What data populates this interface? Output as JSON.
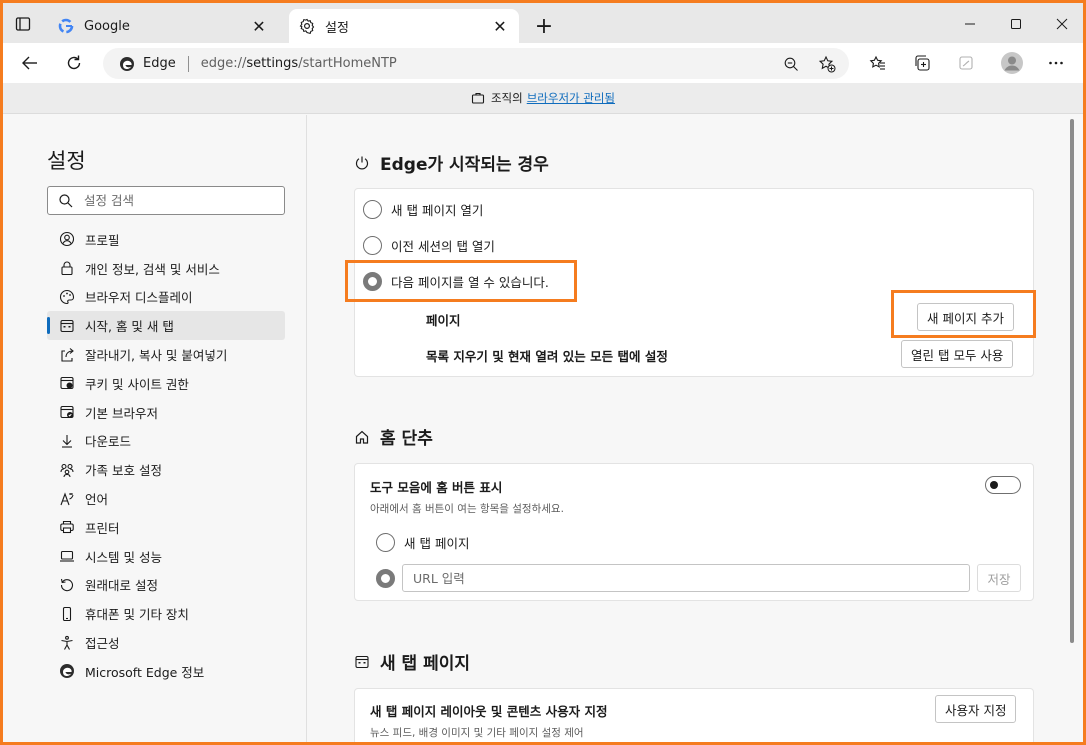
{
  "browser": {
    "tabs": [
      {
        "title": "Google",
        "favicon": "google-icon",
        "active": false
      },
      {
        "title": "설정",
        "favicon": "gear-icon",
        "active": true
      }
    ],
    "address": {
      "site_name": "Edge",
      "url_prefix": "edge://",
      "url_host": "settings",
      "url_path": "/startHomeNTP"
    },
    "managed": {
      "prefix": "조직의",
      "link": "브라우저가 관리됨"
    }
  },
  "sidebar": {
    "title": "설정",
    "search_placeholder": "설정 검색",
    "items": [
      {
        "label": "프로필",
        "icon": "profile-icon"
      },
      {
        "label": "개인 정보, 검색 및 서비스",
        "icon": "lock-icon"
      },
      {
        "label": "브라우저 디스플레이",
        "icon": "palette-icon"
      },
      {
        "label": "시작, 홈 및 새 탭",
        "icon": "home-grid-icon",
        "active": true
      },
      {
        "label": "잘라내기, 복사 및 붙여넣기",
        "icon": "share-icon"
      },
      {
        "label": "쿠키 및 사이트 권한",
        "icon": "cookie-icon"
      },
      {
        "label": "기본 브라우저",
        "icon": "browser-icon"
      },
      {
        "label": "다운로드",
        "icon": "download-icon"
      },
      {
        "label": "가족 보호 설정",
        "icon": "family-icon"
      },
      {
        "label": "언어",
        "icon": "language-icon"
      },
      {
        "label": "프린터",
        "icon": "printer-icon"
      },
      {
        "label": "시스템 및 성능",
        "icon": "laptop-icon"
      },
      {
        "label": "원래대로 설정",
        "icon": "reset-icon"
      },
      {
        "label": "휴대폰 및 기타 장치",
        "icon": "phone-icon"
      },
      {
        "label": "접근성",
        "icon": "accessibility-icon"
      },
      {
        "label": "Microsoft Edge 정보",
        "icon": "edge-icon"
      }
    ]
  },
  "startup": {
    "title": "Edge가 시작되는 경우",
    "options": [
      {
        "label": "새 탭 페이지 열기",
        "checked": false
      },
      {
        "label": "이전 세션의 탭 열기",
        "checked": false
      },
      {
        "label": "다음 페이지를 열 수 있습니다.",
        "checked": true
      }
    ],
    "pages_label": "페이지",
    "add_page_button": "새 페이지 추가",
    "clear_label": "목록 지우기 및 현재 열려 있는 모든 탭에 설정",
    "use_open_tabs_button": "열린 탭 모두 사용"
  },
  "home": {
    "title": "홈 단추",
    "show_label": "도구 모음에 홈 버튼 표시",
    "show_desc": "아래에서 홈 버튼이 여는 항목을 설정하세요.",
    "option_ntp": "새 탭 페이지",
    "url_placeholder": "URL 입력",
    "save_button": "저장"
  },
  "newtab": {
    "title": "새 탭 페이지",
    "customize_label": "새 탭 페이지 레이아웃 및 콘텐츠 사용자 지정",
    "customize_desc": "뉴스 피드, 배경 이미지 및 기타 페이지 설정 제어",
    "customize_button": "사용자 지정"
  }
}
